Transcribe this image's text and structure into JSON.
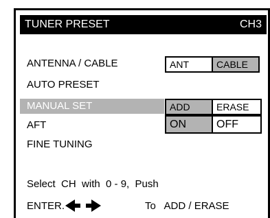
{
  "title": {
    "left": "TUNER PRESET",
    "right": "CH3"
  },
  "menu": {
    "antenna_cable": "ANTENNA / CABLE",
    "auto_preset": "AUTO PRESET",
    "manual_set": "MANUAL SET",
    "aft": "AFT",
    "fine_tuning": "FINE TUNING"
  },
  "options": {
    "ant": "ANT",
    "cable": "CABLE",
    "add": "ADD",
    "erase": "ERASE",
    "on": "ON",
    "off": "OFF"
  },
  "instructions": {
    "line1": "Select  CH  with  0 - 9,  Push",
    "line2_start": "ENTER.",
    "line2_end": "To   ADD / ERASE"
  },
  "colors": {
    "highlight": "#b3b3b3",
    "titlebar": "#000000"
  },
  "icons": {
    "left_arrow": "left-arrow-icon",
    "right_arrow": "right-arrow-icon"
  }
}
